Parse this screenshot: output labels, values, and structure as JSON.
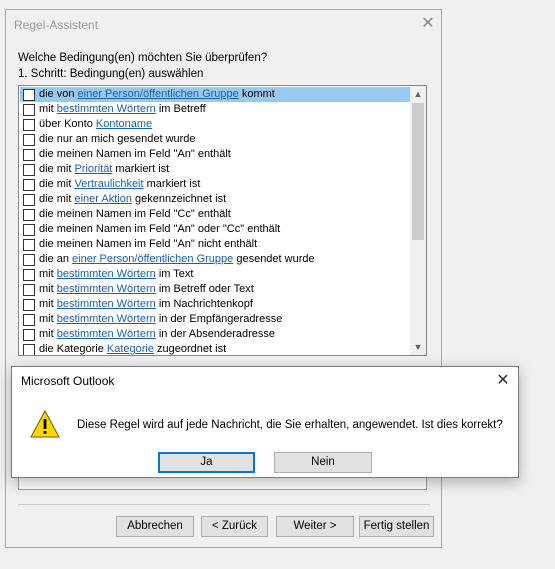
{
  "wizard": {
    "title": "Regel-Assistent",
    "close_glyph": "✕",
    "question": "Welche Bedingung(en) möchten Sie überprüfen?",
    "step": "1. Schritt: Bedingung(en) auswählen",
    "conditions": [
      {
        "pre": "die von ",
        "link": "einer Person/öffentlichen Gruppe",
        "post": " kommt",
        "selected": true
      },
      {
        "pre": "mit ",
        "link": "bestimmten Wörtern",
        "post": " im Betreff",
        "selected": false
      },
      {
        "pre": "über Konto ",
        "link": "Kontoname",
        "post": "",
        "selected": false
      },
      {
        "pre": "die nur an mich gesendet wurde",
        "link": "",
        "post": "",
        "selected": false
      },
      {
        "pre": "die meinen Namen im Feld \"An\" enthält",
        "link": "",
        "post": "",
        "selected": false
      },
      {
        "pre": "die mit ",
        "link": "Priorität",
        "post": " markiert ist",
        "selected": false
      },
      {
        "pre": "die mit ",
        "link": "Vertraulichkeit",
        "post": " markiert ist",
        "selected": false
      },
      {
        "pre": "die mit ",
        "link": "einer Aktion",
        "post": " gekennzeichnet ist",
        "selected": false
      },
      {
        "pre": "die meinen Namen im Feld \"Cc\" enthält",
        "link": "",
        "post": "",
        "selected": false
      },
      {
        "pre": "die meinen Namen im Feld \"An\" oder \"Cc\" enthält",
        "link": "",
        "post": "",
        "selected": false
      },
      {
        "pre": "die meinen Namen im Feld \"An\" nicht enthält",
        "link": "",
        "post": "",
        "selected": false
      },
      {
        "pre": "die an ",
        "link": "einer Person/öffentlichen Gruppe",
        "post": " gesendet wurde",
        "selected": false
      },
      {
        "pre": "mit ",
        "link": "bestimmten Wörtern",
        "post": " im Text",
        "selected": false
      },
      {
        "pre": "mit ",
        "link": "bestimmten Wörtern",
        "post": " im Betreff oder Text",
        "selected": false
      },
      {
        "pre": "mit ",
        "link": "bestimmten Wörtern",
        "post": " im Nachrichtenkopf",
        "selected": false
      },
      {
        "pre": "mit ",
        "link": "bestimmten Wörtern",
        "post": " in der Empfängeradresse",
        "selected": false
      },
      {
        "pre": "mit ",
        "link": "bestimmten Wörtern",
        "post": " in der Absenderadresse",
        "selected": false
      },
      {
        "pre": "die Kategorie ",
        "link": "Kategorie",
        "post": " zugeordnet ist",
        "selected": false
      }
    ],
    "buttons": {
      "cancel": "Abbrechen",
      "back": "< Zurück",
      "next": "Weiter >",
      "finish": "Fertig stellen"
    }
  },
  "msgbox": {
    "title": "Microsoft Outlook",
    "close_glyph": "✕",
    "text": "Diese Regel wird auf jede Nachricht, die Sie erhalten, angewendet. Ist dies korrekt?",
    "icon": "warning-icon",
    "buttons": {
      "yes": "Ja",
      "no": "Nein"
    }
  },
  "colors": {
    "selection": "#99c9ef",
    "link": "#1e5fa8",
    "focus_border": "#0078d7",
    "warning_yellow": "#ffd800"
  }
}
